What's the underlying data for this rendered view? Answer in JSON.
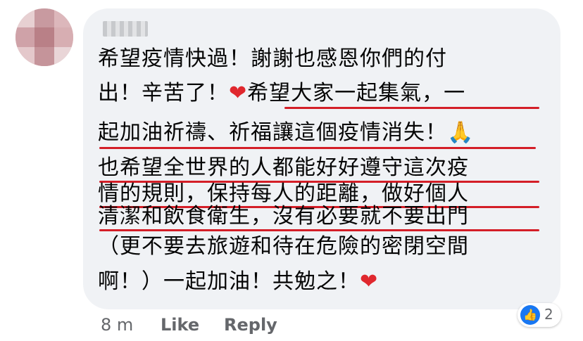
{
  "author": {
    "name": ""
  },
  "comment_lines": [
    "希望疫情快過！謝謝也感恩你們的付",
    "出！辛苦了！",
    "希望大家一起集氣，一",
    "起加油祈禱、祈福讓這個疫情消失！",
    "也希望全世界的人都能好好遵守這次疫",
    "情的規則，保持每人的距離，做好個人",
    "清潔和飲食衛生，沒有必要就不要出門",
    "（更不要去旅遊和待在危險的密閉空間",
    "啊！）一起加油！共勉之！"
  ],
  "emoji": {
    "heart": "❤",
    "pray": "🙏"
  },
  "reactions": {
    "count": "2",
    "icon": "like-icon"
  },
  "meta": {
    "time": "8 m",
    "like_label": "Like",
    "reply_label": "Reply"
  },
  "colors": {
    "bubble": "#f0f2f5",
    "underline": "#d41e27",
    "heart": "#e0282e",
    "like_blue": "#1877f2"
  }
}
